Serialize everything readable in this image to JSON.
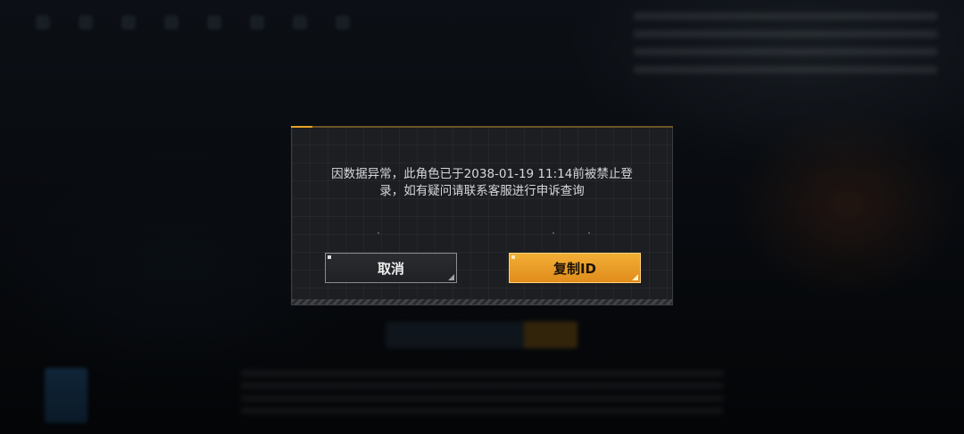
{
  "dialog": {
    "message": "因数据异常，此角色已于2038-01-19 11:14前被禁止登录，如有疑问请联系客服进行申诉查询",
    "cancel_label": "取消",
    "copy_id_label": "复制ID"
  },
  "colors": {
    "accent": "#e8a227",
    "dialog_bg": "#1c1e21",
    "text": "#d6d8da"
  }
}
